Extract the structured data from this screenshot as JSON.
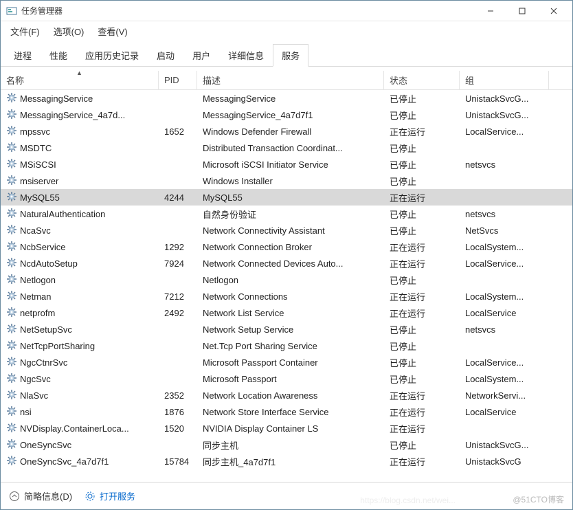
{
  "title": "任务管理器",
  "menubar": {
    "file": "文件(F)",
    "options": "选项(O)",
    "view": "查看(V)"
  },
  "tabs": [
    "进程",
    "性能",
    "应用历史记录",
    "启动",
    "用户",
    "详细信息",
    "服务"
  ],
  "activeTab": 6,
  "columns": {
    "name": "名称",
    "pid": "PID",
    "desc": "描述",
    "status": "状态",
    "group": "组"
  },
  "selected": 6,
  "services": [
    {
      "name": "MessagingService",
      "pid": "",
      "desc": "MessagingService",
      "status": "已停止",
      "group": "UnistackSvcG..."
    },
    {
      "name": "MessagingService_4a7d...",
      "pid": "",
      "desc": "MessagingService_4a7d7f1",
      "status": "已停止",
      "group": "UnistackSvcG..."
    },
    {
      "name": "mpssvc",
      "pid": "1652",
      "desc": "Windows Defender Firewall",
      "status": "正在运行",
      "group": "LocalService..."
    },
    {
      "name": "MSDTC",
      "pid": "",
      "desc": "Distributed Transaction Coordinat...",
      "status": "已停止",
      "group": ""
    },
    {
      "name": "MSiSCSI",
      "pid": "",
      "desc": "Microsoft iSCSI Initiator Service",
      "status": "已停止",
      "group": "netsvcs"
    },
    {
      "name": "msiserver",
      "pid": "",
      "desc": "Windows Installer",
      "status": "已停止",
      "group": ""
    },
    {
      "name": "MySQL55",
      "pid": "4244",
      "desc": "MySQL55",
      "status": "正在运行",
      "group": ""
    },
    {
      "name": "NaturalAuthentication",
      "pid": "",
      "desc": "自然身份验证",
      "status": "已停止",
      "group": "netsvcs"
    },
    {
      "name": "NcaSvc",
      "pid": "",
      "desc": "Network Connectivity Assistant",
      "status": "已停止",
      "group": "NetSvcs"
    },
    {
      "name": "NcbService",
      "pid": "1292",
      "desc": "Network Connection Broker",
      "status": "正在运行",
      "group": "LocalSystem..."
    },
    {
      "name": "NcdAutoSetup",
      "pid": "7924",
      "desc": "Network Connected Devices Auto...",
      "status": "正在运行",
      "group": "LocalService..."
    },
    {
      "name": "Netlogon",
      "pid": "",
      "desc": "Netlogon",
      "status": "已停止",
      "group": ""
    },
    {
      "name": "Netman",
      "pid": "7212",
      "desc": "Network Connections",
      "status": "正在运行",
      "group": "LocalSystem..."
    },
    {
      "name": "netprofm",
      "pid": "2492",
      "desc": "Network List Service",
      "status": "正在运行",
      "group": "LocalService"
    },
    {
      "name": "NetSetupSvc",
      "pid": "",
      "desc": "Network Setup Service",
      "status": "已停止",
      "group": "netsvcs"
    },
    {
      "name": "NetTcpPortSharing",
      "pid": "",
      "desc": "Net.Tcp Port Sharing Service",
      "status": "已停止",
      "group": ""
    },
    {
      "name": "NgcCtnrSvc",
      "pid": "",
      "desc": "Microsoft Passport Container",
      "status": "已停止",
      "group": "LocalService..."
    },
    {
      "name": "NgcSvc",
      "pid": "",
      "desc": "Microsoft Passport",
      "status": "已停止",
      "group": "LocalSystem..."
    },
    {
      "name": "NlaSvc",
      "pid": "2352",
      "desc": "Network Location Awareness",
      "status": "正在运行",
      "group": "NetworkServi..."
    },
    {
      "name": "nsi",
      "pid": "1876",
      "desc": "Network Store Interface Service",
      "status": "正在运行",
      "group": "LocalService"
    },
    {
      "name": "NVDisplay.ContainerLoca...",
      "pid": "1520",
      "desc": "NVIDIA Display Container LS",
      "status": "正在运行",
      "group": ""
    },
    {
      "name": "OneSyncSvc",
      "pid": "",
      "desc": "同步主机",
      "status": "已停止",
      "group": "UnistackSvcG..."
    },
    {
      "name": "OneSyncSvc_4a7d7f1",
      "pid": "15784",
      "desc": "同步主机_4a7d7f1",
      "status": "正在运行",
      "group": "UnistackSvcG"
    }
  ],
  "footer": {
    "brief": "简略信息(D)",
    "openServices": "打开服务"
  },
  "watermark": "@51CTO博客",
  "watermark2": "https://blog.csdn.net/wei..."
}
